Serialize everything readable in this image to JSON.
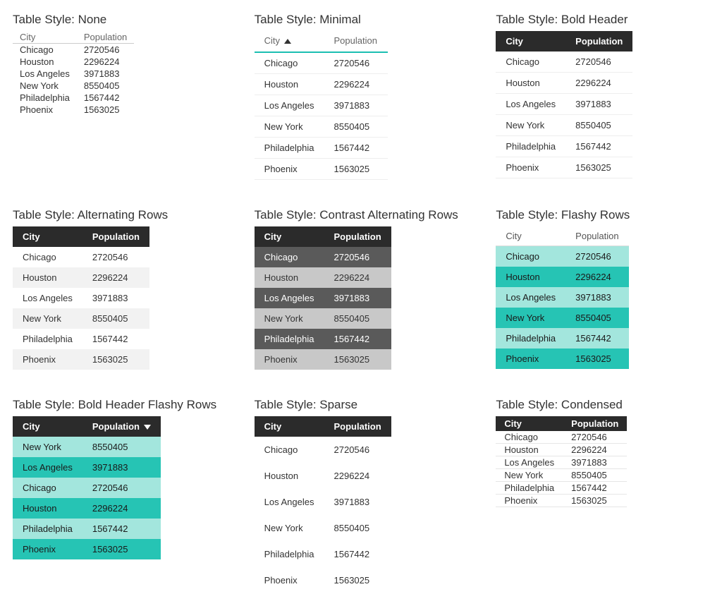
{
  "columns": {
    "city": "City",
    "population": "Population"
  },
  "rows": [
    {
      "city": "Chicago",
      "population": "2720546"
    },
    {
      "city": "Houston",
      "population": "2296224"
    },
    {
      "city": "Los Angeles",
      "population": "3971883"
    },
    {
      "city": "New York",
      "population": "8550405"
    },
    {
      "city": "Philadelphia",
      "population": "1567442"
    },
    {
      "city": "Phoenix",
      "population": "1563025"
    }
  ],
  "rows_desc_population": [
    {
      "city": "New York",
      "population": "8550405"
    },
    {
      "city": "Los Angeles",
      "population": "3971883"
    },
    {
      "city": "Chicago",
      "population": "2720546"
    },
    {
      "city": "Houston",
      "population": "2296224"
    },
    {
      "city": "Philadelphia",
      "population": "1567442"
    },
    {
      "city": "Phoenix",
      "population": "1563025"
    }
  ],
  "tables": {
    "none": {
      "title": "Table Style: None",
      "class": "t-none",
      "sort": null,
      "data": "rows"
    },
    "minimal": {
      "title": "Table Style: Minimal",
      "class": "t-minimal",
      "sort": "city-asc",
      "data": "rows"
    },
    "bold": {
      "title": "Table Style: Bold Header",
      "class": "t-bold",
      "sort": null,
      "data": "rows"
    },
    "alt": {
      "title": "Table Style: Alternating Rows",
      "class": "t-alt",
      "sort": null,
      "data": "rows"
    },
    "contrast": {
      "title": "Table Style: Contrast Alternating Rows",
      "class": "t-contrast",
      "sort": null,
      "data": "rows"
    },
    "flashy": {
      "title": "Table Style: Flashy Rows",
      "class": "t-flashy",
      "sort": null,
      "data": "rows"
    },
    "boldflashy": {
      "title": "Table Style: Bold Header Flashy Rows",
      "class": "t-bold-flashy",
      "sort": "pop-desc",
      "data": "rows_desc_population"
    },
    "sparse": {
      "title": "Table Style: Sparse",
      "class": "t-sparse",
      "sort": null,
      "data": "rows"
    },
    "condensed": {
      "title": "Table Style: Condensed",
      "class": "t-condensed",
      "sort": null,
      "data": "rows"
    }
  },
  "order": [
    "none",
    "minimal",
    "bold",
    "alt",
    "contrast",
    "flashy",
    "boldflashy",
    "sparse",
    "condensed"
  ],
  "colors": {
    "teal": "#1cbfb2",
    "teal_light": "#a3e6dd",
    "teal_dark": "#26c4b4",
    "header_dark": "#2b2b2b"
  }
}
